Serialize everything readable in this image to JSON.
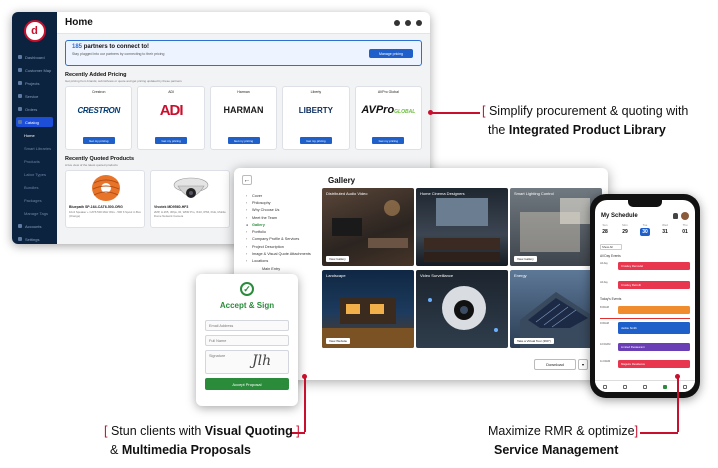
{
  "dashboard": {
    "title": "Home",
    "logo_letter": "d",
    "nav": [
      {
        "label": "Dashboard"
      },
      {
        "label": "Customer Map"
      },
      {
        "label": "Projects"
      },
      {
        "label": "Service"
      },
      {
        "label": "Orders"
      },
      {
        "label": "Catalog",
        "active": true
      },
      {
        "label": "Home",
        "sub": true,
        "active": true
      },
      {
        "label": "Smart Libraries",
        "sub": true
      },
      {
        "label": "Products",
        "sub": true
      },
      {
        "label": "Labor Types",
        "sub": true
      },
      {
        "label": "Bundles",
        "sub": true
      },
      {
        "label": "Packages",
        "sub": true
      },
      {
        "label": "Manage Tags",
        "sub": true
      },
      {
        "label": "Accounts"
      },
      {
        "label": "Settings"
      }
    ],
    "banner": {
      "count": "185",
      "title_rest": "partners to connect to!",
      "subtitle": "Stay plugged into our partners by connecting to their pricing",
      "button": "Manage pricing"
    },
    "recently_added": {
      "title": "Recently Added Pricing",
      "subtitle": "Get pricing from brands; submit/view or quote and get pricing updated by these partners",
      "view_all": "View all available pricing",
      "brands": [
        {
          "name": "Crestron",
          "logo": "CRESTRON",
          "button": "Get my pricing"
        },
        {
          "name": "ADI",
          "logo": "ADI",
          "button": "Get my pricing"
        },
        {
          "name": "Harman",
          "logo": "HARMAN",
          "button": "Get my pricing"
        },
        {
          "name": "Liberty",
          "logo": "LIBERTY",
          "button": "Get my pricing"
        },
        {
          "name": "AVPro Global",
          "logo": "AVPro",
          "logo_sub": "GLOBAL",
          "button": "Get my pricing"
        }
      ]
    },
    "recently_quoted": {
      "title": "Recently Quoted Products",
      "subtitle": "A live view of the latest quoted products",
      "products": [
        {
          "name": "Bluepath SP-164-CAT6-500-ORG",
          "desc": "10x4 Speaker + CAT6 500 MHz Wire - 500 ft Spool in Box (Orange)"
        },
        {
          "name": "Vivotek MD9560-HF3",
          "desc": "2MP, H.265, 30fps, IR, WDR Pro, IK10, IP66, PoE, Mobile Dome Network Camera"
        },
        {
          "name": "",
          "desc": ""
        }
      ]
    }
  },
  "gallery": {
    "title": "Gallery",
    "menu": [
      {
        "label": "Cover",
        "caret": true
      },
      {
        "label": "Philosophy",
        "caret": true
      },
      {
        "label": "Why Choose Us",
        "caret": true
      },
      {
        "label": "Meet the Team",
        "caret": true
      },
      {
        "label": "Gallery",
        "active": true
      },
      {
        "label": "Portfolio",
        "caret": true
      },
      {
        "label": "Company Profile & Services",
        "caret": true
      },
      {
        "label": "Project Description",
        "caret": true
      },
      {
        "label": "Image & Visual Quote Attachments",
        "caret": true
      },
      {
        "label": "Locations",
        "caret": true
      },
      {
        "label": "Main Entry",
        "sub": true
      }
    ],
    "tiles": [
      {
        "label": "Distributed Audio Video",
        "button": "View Gallery",
        "color": "#3a2e28"
      },
      {
        "label": "Home Cinema Designers",
        "button": "",
        "color": "#2b3440"
      },
      {
        "label": "Smart Lighting Control",
        "button": "View Gallery",
        "color": "#4a5057"
      },
      {
        "label": "Landscape",
        "button": "View Website",
        "color": "#17324e"
      },
      {
        "label": "Video Surveillance",
        "button": "",
        "color": "#25303c"
      },
      {
        "label": "Energy",
        "button": "Take a Virtual Tour (360°)",
        "color": "#39506b"
      }
    ],
    "download": "Download"
  },
  "sign": {
    "title": "Accept & Sign",
    "fields": [
      "Email Address",
      "Full Name"
    ],
    "signature_label": "Signature",
    "signature_scribble": "Jlh",
    "button": "Accept Proposal"
  },
  "phone": {
    "title": "My Schedule",
    "days": [
      {
        "n": "Sun",
        "d": "28"
      },
      {
        "n": "Mon",
        "d": "29"
      },
      {
        "n": "Tue",
        "d": "30",
        "selected": true
      },
      {
        "n": "Wed",
        "d": "31"
      },
      {
        "n": "Thu",
        "d": "01"
      }
    ],
    "show_all": "Show All",
    "all_day": "All Day Events",
    "todays": "Today's Events",
    "all_day_rows": [
      {
        "label": "All day",
        "event": "Crowley Remodel",
        "color": "#e8364f"
      },
      {
        "label": "All day",
        "event": "Crowley Retrofit",
        "color": "#e8364f"
      }
    ],
    "today_rows": [
      {
        "time": "8:00AM",
        "event": "",
        "color": "#f08c2e"
      },
      {
        "time": "9:00AM",
        "event": "Jackie Smith",
        "color": "#1f5fc9"
      },
      {
        "time": "10:00AM",
        "event": "Limited Restaurant",
        "color": "#6a3fb5"
      },
      {
        "time": "11:00AM",
        "event": "Maguire Residence",
        "color": "#e8364f"
      }
    ]
  },
  "callouts": {
    "library": {
      "line1": "Simplify procurement & quoting with",
      "line2_pre": "the ",
      "line2_bold": "Integrated Product Library"
    },
    "visual": {
      "line1_pre": "Stun clients with ",
      "line1_bold": "Visual Quoting",
      "line2_pre": "& ",
      "line2_bold": "Multimedia Proposals"
    },
    "rmr": {
      "line1": "Maximize RMR & optimize",
      "line2_bold": "Service Management"
    },
    "bracket_open": "[",
    "bracket_close": "]",
    "accent_color": "#c8102e"
  }
}
